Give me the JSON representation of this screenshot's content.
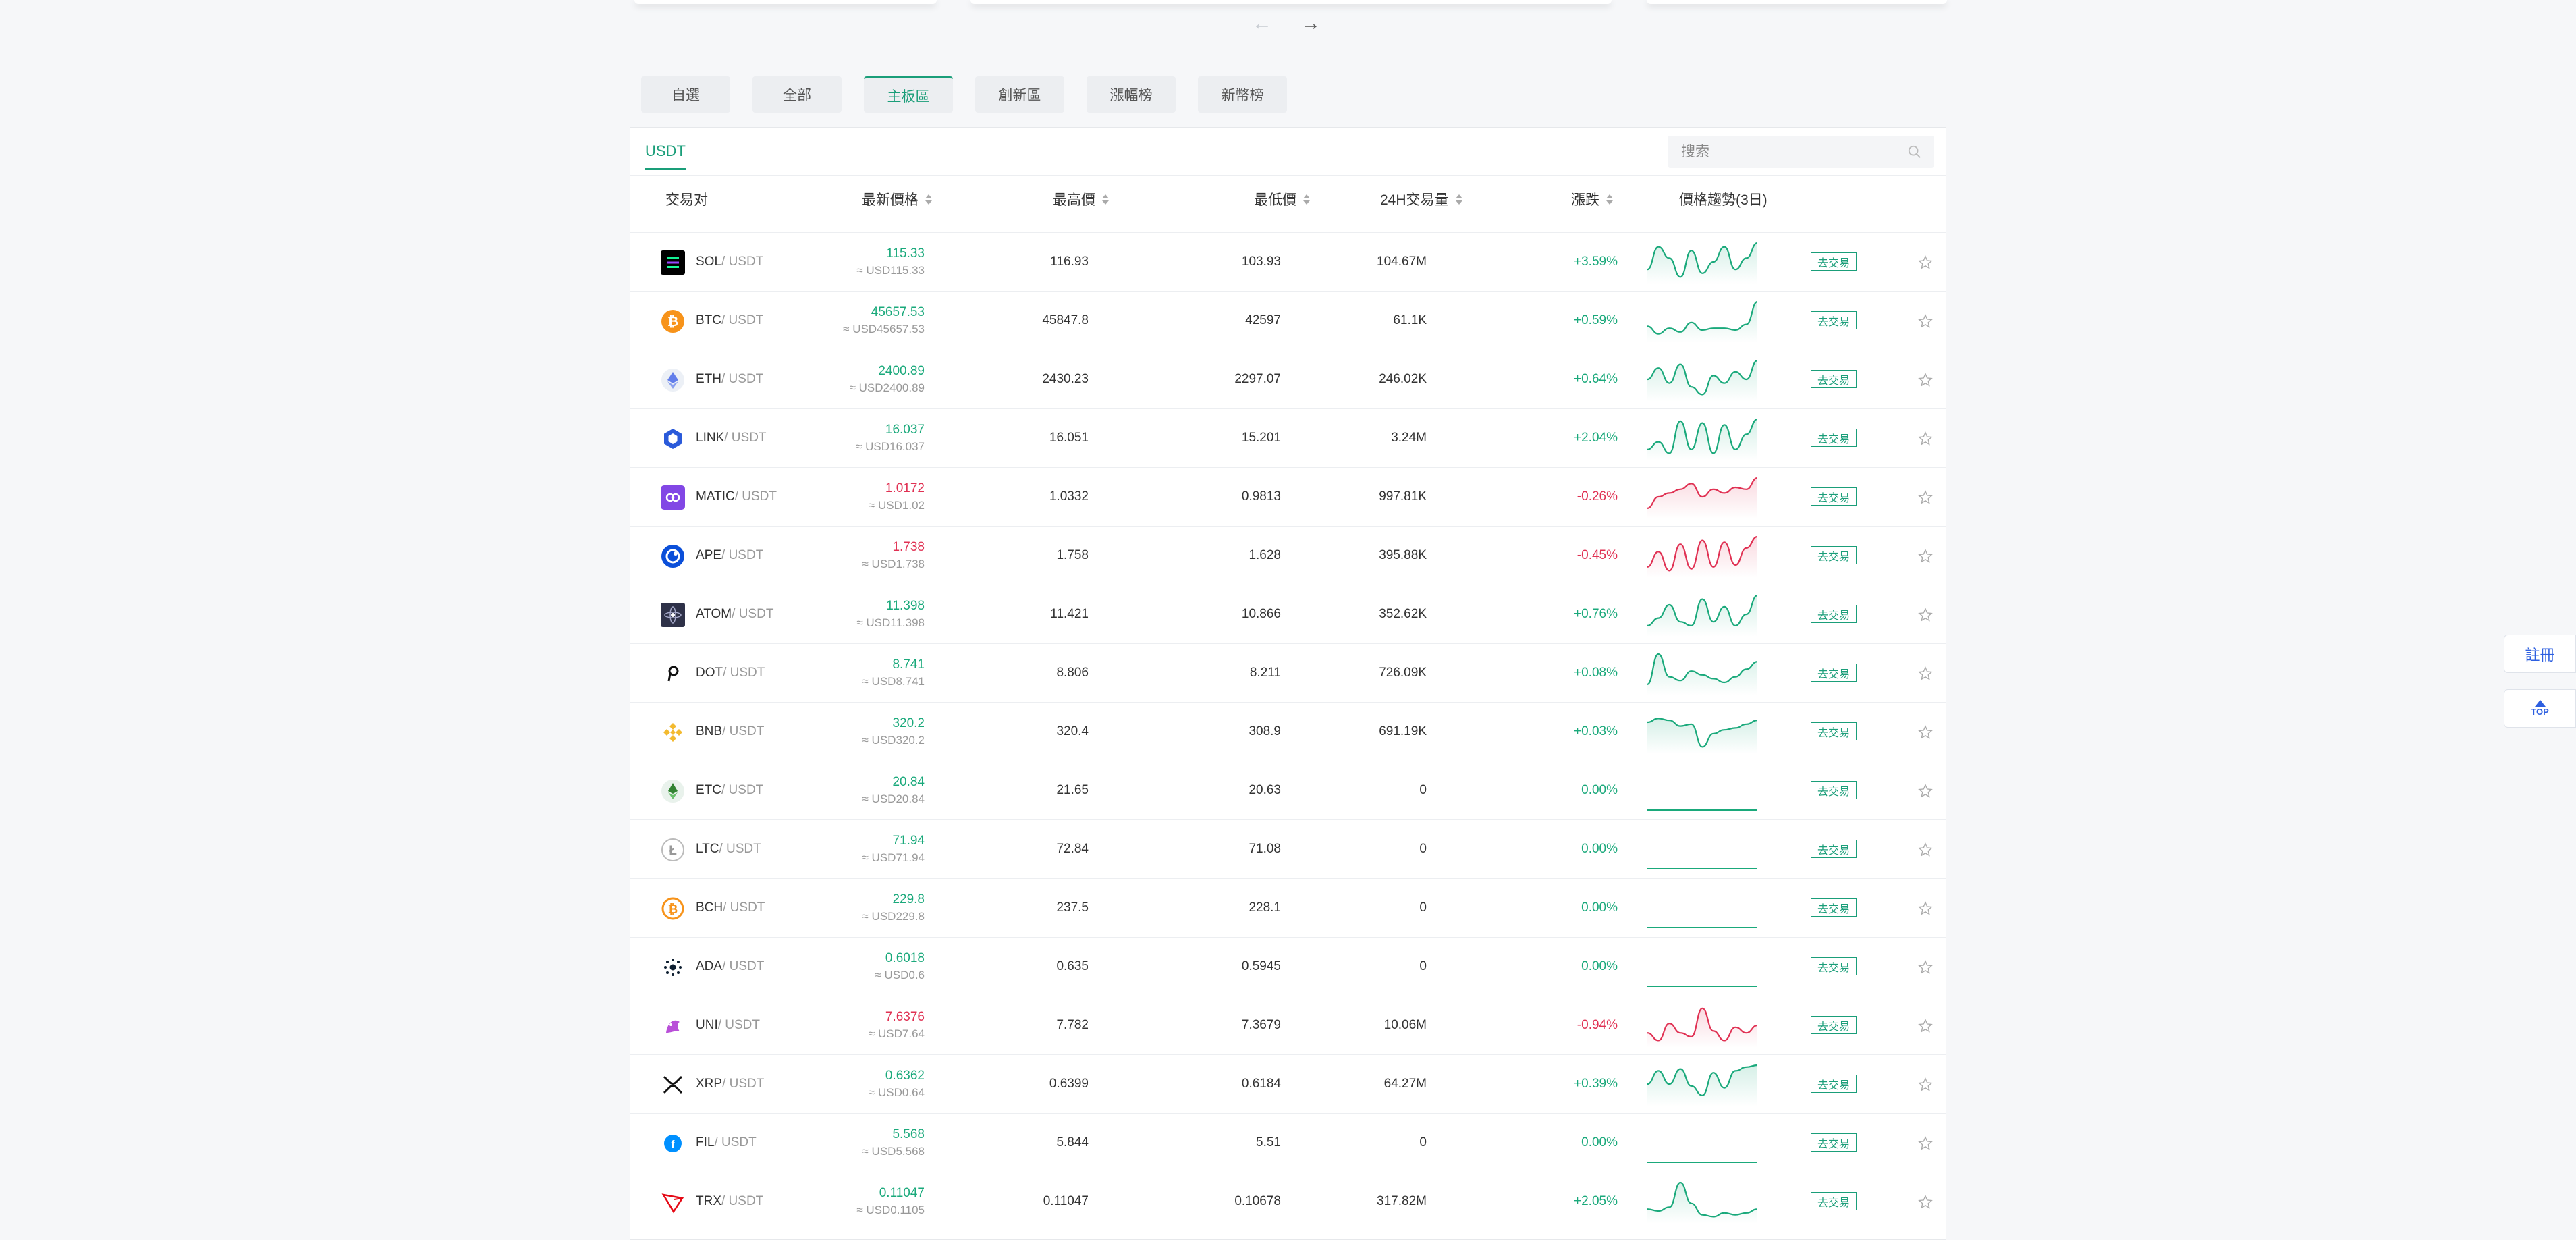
{
  "nav": {
    "prev_arrow": "←",
    "next_arrow": "→"
  },
  "market_tabs": [
    {
      "label": "自選",
      "active": false
    },
    {
      "label": "全部",
      "active": false
    },
    {
      "label": "主板區",
      "active": true
    },
    {
      "label": "創新區",
      "active": false
    },
    {
      "label": "漲幅榜",
      "active": false
    },
    {
      "label": "新幣榜",
      "active": false
    }
  ],
  "quote_tab": "USDT",
  "search": {
    "placeholder": "搜索"
  },
  "columns": {
    "pair": "交易对",
    "last_price": "最新價格",
    "high": "最高價",
    "low": "最低價",
    "volume": "24H交易量",
    "change": "漲跌",
    "trend": "價格趨勢(3日)"
  },
  "colors": {
    "accent": "#1a9e79",
    "up": "#1aa97b",
    "down": "#e03153",
    "link_blue": "#2d5fe0"
  },
  "rows": [
    {
      "base": "SOL",
      "quote": "/ USDT",
      "price": "115.33",
      "usd": "≈ USD115.33",
      "high": "116.93",
      "low": "103.93",
      "volume": "104.67M",
      "change": "+3.59%",
      "dir": "up",
      "icon": "solana-icon",
      "trend": [
        0.3,
        0.9,
        0.6,
        0.1,
        0.8,
        0.2,
        0.5,
        0.9,
        0.3,
        0.6,
        1.0
      ],
      "trade_label": "去交易"
    },
    {
      "base": "BTC",
      "quote": "/ USDT",
      "price": "45657.53",
      "usd": "≈ USD45657.53",
      "high": "45847.8",
      "low": "42597",
      "volume": "61.1K",
      "change": "+0.59%",
      "dir": "up",
      "icon": "bitcoin-icon",
      "trend": [
        0.35,
        0.15,
        0.3,
        0.2,
        0.45,
        0.25,
        0.3,
        0.3,
        0.25,
        0.4,
        1.0
      ],
      "trade_label": "去交易"
    },
    {
      "base": "ETH",
      "quote": "/ USDT",
      "price": "2400.89",
      "usd": "≈ USD2400.89",
      "high": "2430.23",
      "low": "2297.07",
      "volume": "246.02K",
      "change": "+0.64%",
      "dir": "up",
      "icon": "ethereum-icon",
      "trend": [
        0.5,
        0.8,
        0.4,
        0.9,
        0.3,
        0.1,
        0.6,
        0.4,
        0.7,
        0.5,
        1.0
      ],
      "trade_label": "去交易"
    },
    {
      "base": "LINK",
      "quote": "/ USDT",
      "price": "16.037",
      "usd": "≈ USD16.037",
      "high": "16.051",
      "low": "15.201",
      "volume": "3.24M",
      "change": "+2.04%",
      "dir": "up",
      "icon": "chainlink-icon",
      "trend": [
        0.2,
        0.4,
        0.1,
        0.95,
        0.2,
        0.9,
        0.1,
        0.85,
        0.2,
        0.6,
        1.0
      ],
      "trade_label": "去交易"
    },
    {
      "base": "MATIC",
      "quote": "/ USDT",
      "price": "1.0172",
      "usd": "≈ USD1.02",
      "high": "1.0332",
      "low": "0.9813",
      "volume": "997.81K",
      "change": "-0.26%",
      "dir": "down",
      "icon": "polygon-icon",
      "trend": [
        0.2,
        0.5,
        0.6,
        0.7,
        0.85,
        0.5,
        0.7,
        0.6,
        0.75,
        0.7,
        1.0
      ],
      "trade_label": "去交易"
    },
    {
      "base": "APE",
      "quote": "/ USDT",
      "price": "1.738",
      "usd": "≈ USD1.738",
      "high": "1.758",
      "low": "1.628",
      "volume": "395.88K",
      "change": "-0.45%",
      "dir": "down",
      "icon": "apecoin-icon",
      "trend": [
        0.2,
        0.6,
        0.1,
        0.8,
        0.15,
        0.9,
        0.2,
        0.85,
        0.25,
        0.7,
        1.0
      ],
      "trade_label": "去交易"
    },
    {
      "base": "ATOM",
      "quote": "/ USDT",
      "price": "11.398",
      "usd": "≈ USD11.398",
      "high": "11.421",
      "low": "10.866",
      "volume": "352.62K",
      "change": "+0.76%",
      "dir": "up",
      "icon": "cosmos-icon",
      "trend": [
        0.2,
        0.4,
        0.75,
        0.3,
        0.2,
        0.9,
        0.3,
        0.7,
        0.2,
        0.5,
        1.0
      ],
      "trade_label": "去交易"
    },
    {
      "base": "DOT",
      "quote": "/ USDT",
      "price": "8.741",
      "usd": "≈ USD8.741",
      "high": "8.806",
      "low": "8.211",
      "volume": "726.09K",
      "change": "+0.08%",
      "dir": "up",
      "icon": "polkadot-icon",
      "trend": [
        0.2,
        1.0,
        0.4,
        0.3,
        0.55,
        0.45,
        0.35,
        0.25,
        0.4,
        0.6,
        0.8
      ],
      "trade_label": "去交易"
    },
    {
      "base": "BNB",
      "quote": "/ USDT",
      "price": "320.2",
      "usd": "≈ USD320.2",
      "high": "320.4",
      "low": "308.9",
      "volume": "691.19K",
      "change": "+0.03%",
      "dir": "up",
      "icon": "binance-icon",
      "trend": [
        0.75,
        0.85,
        0.8,
        0.65,
        0.7,
        0.1,
        0.45,
        0.55,
        0.6,
        0.7,
        0.8
      ],
      "trade_label": "去交易"
    },
    {
      "base": "ETC",
      "quote": "/ USDT",
      "price": "20.84",
      "usd": "≈ USD20.84",
      "high": "21.65",
      "low": "20.63",
      "volume": "0",
      "change": "0.00%",
      "dir": "flat",
      "icon": "ethereum-classic-icon",
      "trend": [
        0,
        0,
        0,
        0,
        0,
        0,
        0,
        0,
        0,
        0,
        0
      ],
      "trade_label": "去交易"
    },
    {
      "base": "LTC",
      "quote": "/ USDT",
      "price": "71.94",
      "usd": "≈ USD71.94",
      "high": "72.84",
      "low": "71.08",
      "volume": "0",
      "change": "0.00%",
      "dir": "flat",
      "icon": "litecoin-icon",
      "trend": [
        0,
        0,
        0,
        0,
        0,
        0,
        0,
        0,
        0,
        0,
        0
      ],
      "trade_label": "去交易"
    },
    {
      "base": "BCH",
      "quote": "/ USDT",
      "price": "229.8",
      "usd": "≈ USD229.8",
      "high": "237.5",
      "low": "228.1",
      "volume": "0",
      "change": "0.00%",
      "dir": "flat",
      "icon": "bitcoin-cash-icon",
      "trend": [
        0,
        0,
        0,
        0,
        0,
        0,
        0,
        0,
        0,
        0,
        0
      ],
      "trade_label": "去交易"
    },
    {
      "base": "ADA",
      "quote": "/ USDT",
      "price": "0.6018",
      "usd": "≈ USD0.6",
      "high": "0.635",
      "low": "0.5945",
      "volume": "0",
      "change": "0.00%",
      "dir": "flat",
      "icon": "cardano-icon",
      "trend": [
        0,
        0,
        0,
        0,
        0,
        0,
        0,
        0,
        0,
        0,
        0
      ],
      "trade_label": "去交易"
    },
    {
      "base": "UNI",
      "quote": "/ USDT",
      "price": "7.6376",
      "usd": "≈ USD7.64",
      "high": "7.782",
      "low": "7.3679",
      "volume": "10.06M",
      "change": "-0.94%",
      "dir": "down",
      "icon": "uniswap-icon",
      "trend": [
        0.3,
        0.1,
        0.55,
        0.3,
        0.2,
        0.95,
        0.35,
        0.1,
        0.45,
        0.3,
        0.5
      ],
      "trade_label": "去交易"
    },
    {
      "base": "XRP",
      "quote": "/ USDT",
      "price": "0.6362",
      "usd": "≈ USD0.64",
      "high": "0.6399",
      "low": "0.6184",
      "volume": "64.27M",
      "change": "+0.39%",
      "dir": "up",
      "icon": "xrp-icon",
      "trend": [
        0.5,
        0.85,
        0.5,
        0.9,
        0.45,
        0.2,
        0.8,
        0.4,
        0.85,
        0.95,
        1.0
      ],
      "trade_label": "去交易"
    },
    {
      "base": "FIL",
      "quote": "/ USDT",
      "price": "5.568",
      "usd": "≈ USD5.568",
      "high": "5.844",
      "low": "5.51",
      "volume": "0",
      "change": "0.00%",
      "dir": "flat",
      "icon": "filecoin-icon",
      "trend": [
        0,
        0,
        0,
        0,
        0,
        0,
        0,
        0,
        0,
        0,
        0
      ],
      "trade_label": "去交易"
    },
    {
      "base": "TRX",
      "quote": "/ USDT",
      "price": "0.11047",
      "usd": "≈ USD0.1105",
      "high": "0.11047",
      "low": "0.10678",
      "volume": "317.82M",
      "change": "+2.05%",
      "dir": "up",
      "icon": "tron-icon",
      "trend": [
        0.3,
        0.25,
        0.35,
        1.0,
        0.45,
        0.15,
        0.1,
        0.2,
        0.15,
        0.2,
        0.3
      ],
      "trade_label": "去交易"
    }
  ],
  "side": {
    "register": "註冊",
    "top": "TOP"
  }
}
